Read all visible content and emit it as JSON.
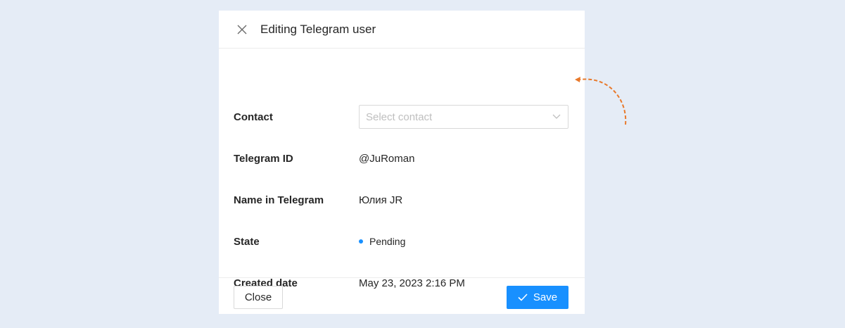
{
  "dialog": {
    "title": "Editing Telegram user",
    "close_icon": "close-icon"
  },
  "fields": {
    "contact": {
      "label": "Contact",
      "placeholder": "Select contact",
      "value": ""
    },
    "telegram_id": {
      "label": "Telegram ID",
      "value": "@JuRoman"
    },
    "name_in_telegram": {
      "label": "Name in Telegram",
      "value": "Юлия JR"
    },
    "state": {
      "label": "State",
      "value": "Pending",
      "dot_color": "#1890ff"
    },
    "created_date": {
      "label": "Created date",
      "value": "May 23, 2023 2:16 PM"
    }
  },
  "footer": {
    "close_label": "Close",
    "save_label": "Save",
    "save_icon": "check-icon"
  },
  "colors": {
    "background": "#e5ecf6",
    "primary": "#1890ff",
    "annotation_arrow": "#e8792b"
  }
}
